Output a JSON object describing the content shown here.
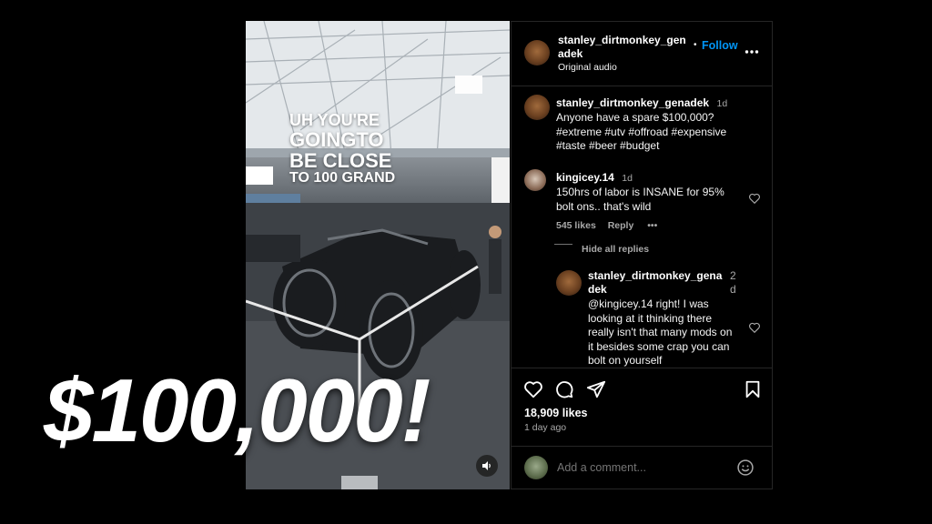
{
  "video": {
    "overlay_lines": [
      "UH YOU'RE",
      "GOINGTO",
      "BE CLOSE",
      "TO 100 GRAND"
    ]
  },
  "thumbnail_caption": "$100,000!",
  "post_header": {
    "username": "stanley_dirtmonkey_genadek",
    "username_line1": "stanley_dirtmonkey_gen",
    "username_line2": "adek",
    "separator": "•",
    "follow_label": "Follow",
    "audio": "Original audio",
    "more_icon": "more-icon"
  },
  "caption": {
    "username": "stanley_dirtmonkey_genadek",
    "time": "1d",
    "text_line1": "Anyone have a spare $100,000?",
    "text_line2": "#extreme #utv #offroad #expensive",
    "text_line3": "#taste #beer #budget"
  },
  "comments": [
    {
      "username": "kingicey.14",
      "time": "1d",
      "text_line1": "150hrs of labor is INSANE for 95%",
      "text_line2": "bolt ons.. that's wild",
      "likes": "545 likes",
      "reply_label": "Reply",
      "more": "•••",
      "hide_replies": "Hide all replies"
    }
  ],
  "reply": {
    "username_line1": "stanley_dirtmonkey_gena",
    "username_line2": "dek",
    "time_line1": "2",
    "time_line2": "d",
    "text_lines": [
      "@kingicey.14 right! I was",
      "looking at it thinking there",
      "really isn't that many mods on",
      "it besides some crap you can",
      "bolt on yourself"
    ]
  },
  "actions": {
    "likes": "18,909 likes",
    "posted": "1 day ago"
  },
  "comment_input": {
    "placeholder": "Add a comment..."
  },
  "colors": {
    "background": "#000000",
    "follow": "#0095f6",
    "muted_text": "#a8a8a8",
    "border": "#262626"
  }
}
